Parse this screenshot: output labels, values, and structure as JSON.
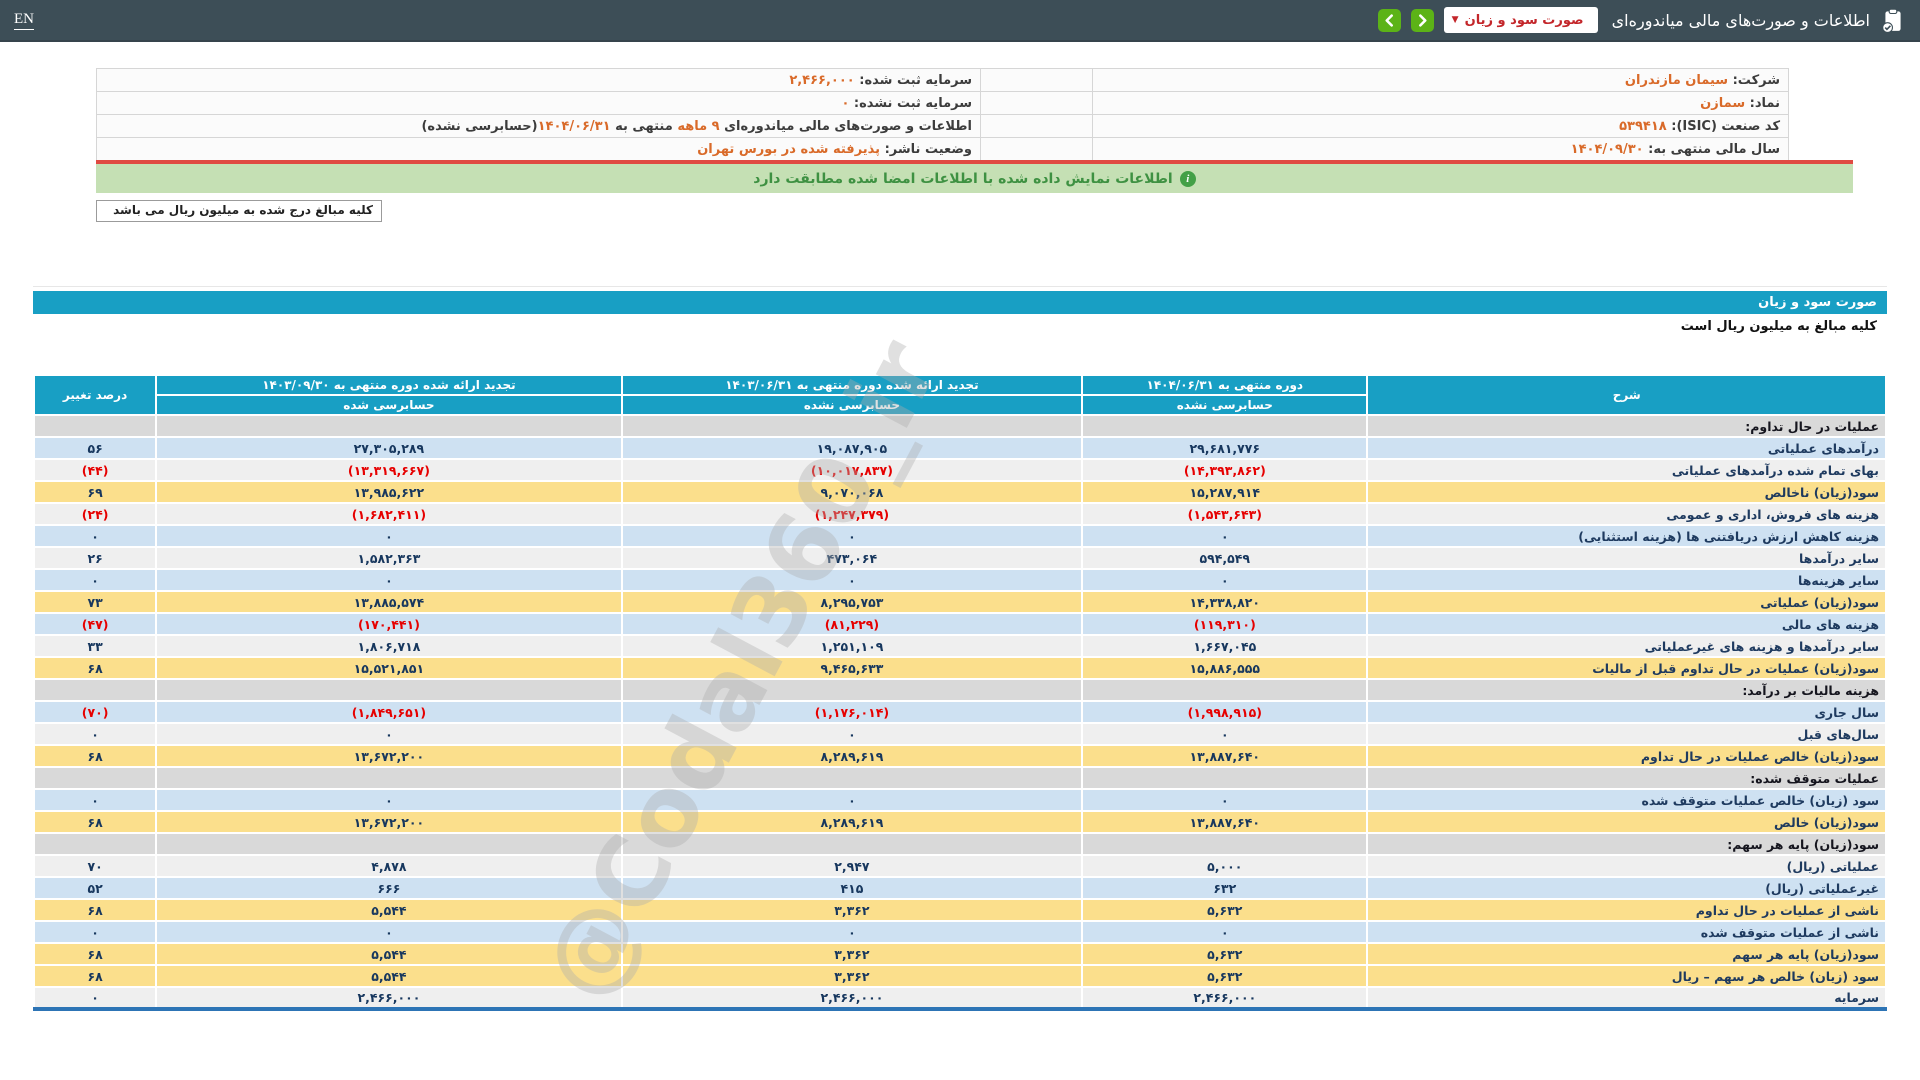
{
  "topbar": {
    "lang_label": "EN",
    "title": "اطلاعات و صورت‌های مالی میاندوره‌ای",
    "dropdown_value": "صورت سود و زیان",
    "dropdown_caret": "▼",
    "accent_green": "#5CB317",
    "bar_color": "#3D4E57"
  },
  "company_info": {
    "rows": [
      {
        "right": {
          "segments": [
            {
              "type": "label",
              "text": "شرکت:  "
            },
            {
              "type": "value",
              "text": "سیمان مازندران"
            }
          ]
        },
        "left": {
          "segments": [
            {
              "type": "label",
              "text": "سرمایه ثبت شده:  "
            },
            {
              "type": "value",
              "text": "۲,۴۶۶,۰۰۰"
            }
          ]
        }
      },
      {
        "right": {
          "segments": [
            {
              "type": "label",
              "text": "نماد:  "
            },
            {
              "type": "value",
              "text": "سمازن"
            }
          ]
        },
        "left": {
          "segments": [
            {
              "type": "label",
              "text": "سرمایه ثبت نشده:  "
            },
            {
              "type": "value",
              "text": "۰"
            }
          ]
        }
      },
      {
        "right": {
          "segments": [
            {
              "type": "label",
              "text": "کد صنعت (ISIC):  "
            },
            {
              "type": "value",
              "text": "۵۳۹۴۱۸"
            }
          ]
        },
        "left": {
          "segments": [
            {
              "type": "label",
              "text": "اطلاعات و صورت‌های مالی میاندوره‌ای "
            },
            {
              "type": "value",
              "text": "۹ ماهه"
            },
            {
              "type": "label",
              "text": " منتهی به "
            },
            {
              "type": "value",
              "text": "۱۴۰۴/۰۶/۳۱"
            },
            {
              "type": "label",
              "text": "(حسابرسی نشده)"
            }
          ]
        }
      },
      {
        "right": {
          "segments": [
            {
              "type": "label",
              "text": "سال مالی منتهی به:  "
            },
            {
              "type": "value",
              "text": "۱۴۰۴/۰۹/۳۰"
            }
          ]
        },
        "left": {
          "segments": [
            {
              "type": "label",
              "text": "وضعیت ناشر:  "
            },
            {
              "type": "value",
              "text": "پذیرفته شده در بورس تهران"
            }
          ]
        }
      }
    ]
  },
  "banner": {
    "match_text": "اطلاعات نمایش داده شده با اطلاعات امضا شده مطابقت دارد",
    "million_note": "کلیه مبالغ درج شده به میلیون ریال می باشد",
    "banner_bg": "#C5E0B4",
    "banner_text_color": "#3E9142",
    "divider_color": "#E04A42"
  },
  "statement": {
    "section_title": "صورت سود و زیان",
    "subtitle": "کلیه مبالغ به میلیون ریال است",
    "header_bg": "#189FC4",
    "highlight_yellow": "#FBDF8C",
    "row_blue": "#CEE1F2",
    "negative_color": "#E60000",
    "columns": {
      "desc": "شرح",
      "c1": {
        "title": "دوره منتهی به ۱۴۰۴/۰۶/۳۱",
        "sub": "حسابرسی نشده"
      },
      "c2": {
        "title": "تجدید ارائه شده دوره منتهی به ۱۴۰۳/۰۶/۳۱",
        "sub": "حسابرسی نشده"
      },
      "c3": {
        "title": "تجدید ارائه شده دوره منتهی به ۱۴۰۳/۰۹/۳۰",
        "sub": "حسابرسی شده"
      },
      "change": "درصد تغییر"
    },
    "rows": [
      {
        "type": "section",
        "style": "section",
        "label": "عملیات در حال تداوم:",
        "values": [
          "",
          "",
          "",
          ""
        ]
      },
      {
        "type": "data",
        "style": "blue",
        "label": "درآمدهای عملیاتی",
        "values": [
          "۲۹,۶۸۱,۷۷۶",
          "۱۹,۰۸۷,۹۰۵",
          "۲۷,۳۰۵,۲۸۹",
          "۵۶"
        ]
      },
      {
        "type": "data",
        "style": "gray",
        "label": "بهای تمام شده درآمدهای عملیاتی",
        "values": [
          "(۱۴,۳۹۳,۸۶۲)",
          "(۱۰,۰۱۷,۸۳۷)",
          "(۱۳,۳۱۹,۶۶۷)",
          "(۴۴)"
        ]
      },
      {
        "type": "data",
        "style": "yellow",
        "label": "سود(زیان) ناخالص",
        "values": [
          "۱۵,۲۸۷,۹۱۴",
          "۹,۰۷۰,۰۶۸",
          "۱۳,۹۸۵,۶۲۲",
          "۶۹"
        ]
      },
      {
        "type": "data",
        "style": "gray",
        "label": "هزینه های فروش، اداری و عمومی",
        "values": [
          "(۱,۵۴۳,۶۴۳)",
          "(۱,۲۴۷,۳۷۹)",
          "(۱,۶۸۲,۴۱۱)",
          "(۲۴)"
        ]
      },
      {
        "type": "data",
        "style": "blue",
        "label": "هزینه کاهش ارزش دریافتنی ها (هزینه استثنایی)",
        "values": [
          "۰",
          "۰",
          "۰",
          "۰"
        ]
      },
      {
        "type": "data",
        "style": "gray",
        "label": "سایر درآمدها",
        "values": [
          "۵۹۴,۵۴۹",
          "۴۷۳,۰۶۴",
          "۱,۵۸۲,۳۶۳",
          "۲۶"
        ]
      },
      {
        "type": "data",
        "style": "blue",
        "label": "سایر هزینه‌ها",
        "values": [
          "۰",
          "۰",
          "۰",
          "۰"
        ]
      },
      {
        "type": "data",
        "style": "yellow",
        "label": "سود(زیان) عملیاتی",
        "values": [
          "۱۴,۳۳۸,۸۲۰",
          "۸,۲۹۵,۷۵۳",
          "۱۳,۸۸۵,۵۷۴",
          "۷۳"
        ]
      },
      {
        "type": "data",
        "style": "blue",
        "label": "هزینه های مالی",
        "values": [
          "(۱۱۹,۳۱۰)",
          "(۸۱,۲۲۹)",
          "(۱۷۰,۴۴۱)",
          "(۴۷)"
        ]
      },
      {
        "type": "data",
        "style": "gray",
        "label": "سایر درآمدها و هزینه های غیرعملیاتی",
        "values": [
          "۱,۶۶۷,۰۴۵",
          "۱,۲۵۱,۱۰۹",
          "۱,۸۰۶,۷۱۸",
          "۳۳"
        ]
      },
      {
        "type": "data",
        "style": "yellow",
        "label": "سود(زیان) عملیات در حال تداوم قبل از مالیات",
        "values": [
          "۱۵,۸۸۶,۵۵۵",
          "۹,۴۶۵,۶۳۳",
          "۱۵,۵۲۱,۸۵۱",
          "۶۸"
        ]
      },
      {
        "type": "section",
        "style": "section",
        "label": "هزینه مالیات بر درآمد:",
        "values": [
          "",
          "",
          "",
          ""
        ]
      },
      {
        "type": "data",
        "style": "blue",
        "label": "سال جاری",
        "values": [
          "(۱,۹۹۸,۹۱۵)",
          "(۱,۱۷۶,۰۱۴)",
          "(۱,۸۴۹,۶۵۱)",
          "(۷۰)"
        ]
      },
      {
        "type": "data",
        "style": "gray",
        "label": "سال‌های قبل",
        "values": [
          "۰",
          "۰",
          "۰",
          "۰"
        ]
      },
      {
        "type": "data",
        "style": "yellow",
        "label": "سود(زیان) خالص عملیات در حال تداوم",
        "values": [
          "۱۳,۸۸۷,۶۴۰",
          "۸,۲۸۹,۶۱۹",
          "۱۳,۶۷۲,۲۰۰",
          "۶۸"
        ]
      },
      {
        "type": "section",
        "style": "section",
        "label": "عملیات متوقف شده:",
        "values": [
          "",
          "",
          "",
          ""
        ]
      },
      {
        "type": "data",
        "style": "blue",
        "label": "سود (زیان) خالص عملیات متوقف شده",
        "values": [
          "۰",
          "۰",
          "۰",
          "۰"
        ]
      },
      {
        "type": "data",
        "style": "yellow",
        "label": "سود(زیان) خالص",
        "values": [
          "۱۳,۸۸۷,۶۴۰",
          "۸,۲۸۹,۶۱۹",
          "۱۳,۶۷۲,۲۰۰",
          "۶۸"
        ]
      },
      {
        "type": "section",
        "style": "section",
        "label": "سود(زیان) پایه هر سهم:",
        "values": [
          "",
          "",
          "",
          ""
        ]
      },
      {
        "type": "data",
        "style": "gray",
        "label": "عملیاتی (ریال)",
        "values": [
          "۵,۰۰۰",
          "۲,۹۴۷",
          "۴,۸۷۸",
          "۷۰"
        ]
      },
      {
        "type": "data",
        "style": "blue",
        "label": "غیرعملیاتی (ریال)",
        "values": [
          "۶۳۲",
          "۴۱۵",
          "۶۶۶",
          "۵۲"
        ]
      },
      {
        "type": "data",
        "style": "yellow",
        "label": "ناشی از عملیات در حال تداوم",
        "values": [
          "۵,۶۳۲",
          "۳,۳۶۲",
          "۵,۵۴۴",
          "۶۸"
        ]
      },
      {
        "type": "data",
        "style": "blue",
        "label": "ناشی از عملیات متوقف شده",
        "values": [
          "۰",
          "۰",
          "۰",
          "۰"
        ]
      },
      {
        "type": "data",
        "style": "yellow",
        "label": "سود(زیان) پایه هر سهم",
        "values": [
          "۵,۶۳۲",
          "۳,۳۶۲",
          "۵,۵۴۴",
          "۶۸"
        ]
      },
      {
        "type": "data",
        "style": "yellow",
        "label": "سود (زیان) خالص هر سهم – ریال",
        "values": [
          "۵,۶۳۲",
          "۳,۳۶۲",
          "۵,۵۴۴",
          "۶۸"
        ]
      },
      {
        "type": "data",
        "style": "gray",
        "label": "سرمایه",
        "values": [
          "۲,۴۶۶,۰۰۰",
          "۲,۴۶۶,۰۰۰",
          "۲,۴۶۶,۰۰۰",
          "۰"
        ]
      }
    ]
  },
  "watermark": "@Codal360_ir"
}
